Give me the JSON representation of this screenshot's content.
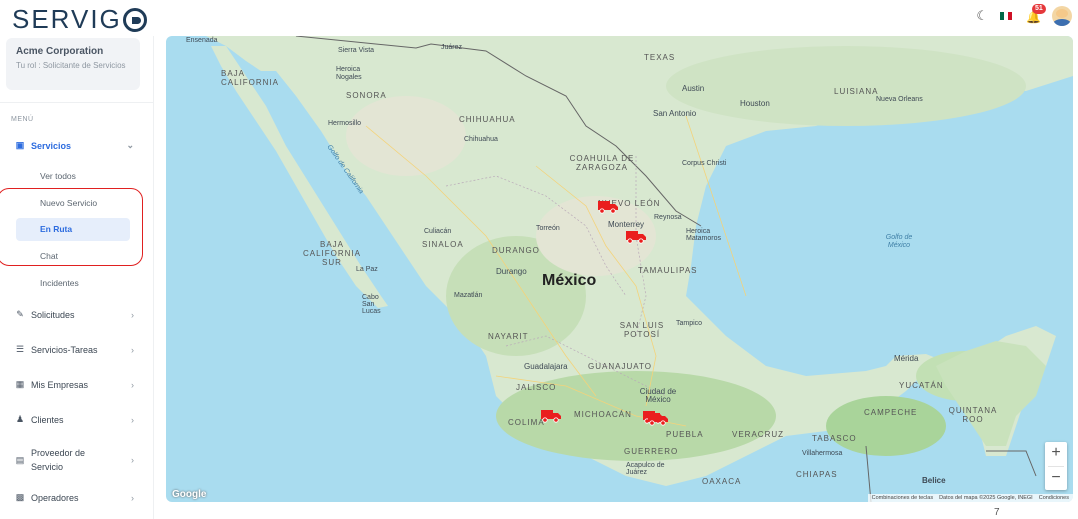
{
  "app": {
    "logo_text": "SERVIG"
  },
  "header": {
    "notification_count": "51"
  },
  "company": {
    "name": "Acme Corporation",
    "role": "Tu rol : Solicitante de Servicios"
  },
  "sidebar": {
    "menu_label": "MENÚ",
    "servicios": {
      "label": "Servicios",
      "subitems": [
        "Ver todos",
        "Nuevo Servicio",
        "En Ruta",
        "Chat",
        "Incidentes"
      ]
    },
    "items": [
      {
        "label": "Solicitudes"
      },
      {
        "label": "Servicios-Tareas"
      },
      {
        "label": "Mis Empresas"
      },
      {
        "label": "Clientes"
      },
      {
        "label": "Proveedor de Servicio"
      },
      {
        "label": "Operadores"
      }
    ]
  },
  "map": {
    "labels": {
      "ensenada": "Ensenada",
      "juarez": "Juárez",
      "texas": "TEXAS",
      "baja_california": "BAJA CALIFORNIA",
      "sierra_vista": "Sierra Vista",
      "heroica_nogales": "Heroica Nogales",
      "sonora": "SONORA",
      "hermosillo": "Hermosillo",
      "chihuahua_state": "CHIHUAHUA",
      "chihuahua_city": "Chihuahua",
      "austin": "Austin",
      "houston": "Houston",
      "san_antonio": "San Antonio",
      "louisiana": "LUISIANA",
      "new_orleans": "Nueva Orleans",
      "coahuila": "COAHUILA DE ZARAGOZA",
      "corpus_christi": "Corpus Christi",
      "nuevo_leon": "NUEVO LEÓN",
      "monterrey": "Monterrey",
      "torreon": "Torreón",
      "durango_state": "DURANGO",
      "durango_city": "Durango",
      "sinaloa": "SINALOA",
      "baja_california_sur": "BAJA CALIFORNIA SUR",
      "la_paz": "La Paz",
      "mexico": "México",
      "tamaulipas": "TAMAULIPAS",
      "golfo_mexico": "Golfo de México",
      "mazatlan": "Mazatlán",
      "nayarit": "NAYARIT",
      "san_luis_potosi": "SAN LUIS POTOSÍ",
      "guadalajara": "Guadalajara",
      "guanajuato": "GUANAJUATO",
      "jalisco": "JALISCO",
      "ciudad_mexico": "Ciudad de México",
      "michoacan": "MICHOACÁN",
      "colima": "COLIMA",
      "puebla": "PUEBLA",
      "veracruz": "VERACRUZ",
      "guerrero": "GUERRERO",
      "oaxaca": "OAXACA",
      "tabasco": "TABASCO",
      "chiapas": "CHIAPAS",
      "campeche": "CAMPECHE",
      "yucatan": "YUCATÁN",
      "quintana_roo": "QUINTANA ROO",
      "merida": "Mérida",
      "belice": "Belice",
      "cabo_san_lucas": "Cabo San Lucas",
      "culiacan": "Culiacán",
      "tampico": "Tampico",
      "villahermosa": "Villahermosa",
      "acapulco": "Acapulco de Juárez",
      "golfo_california": "Golfo de California",
      "reynosa": "Reynosa",
      "matamoros": "Heroica Matamoros"
    },
    "google_label": "Google",
    "attribution": [
      "Combinaciones de teclas",
      "Datos del mapa ©2025 Google, INEGI",
      "Condiciones"
    ],
    "trucks": 5
  },
  "page_number": "7"
}
